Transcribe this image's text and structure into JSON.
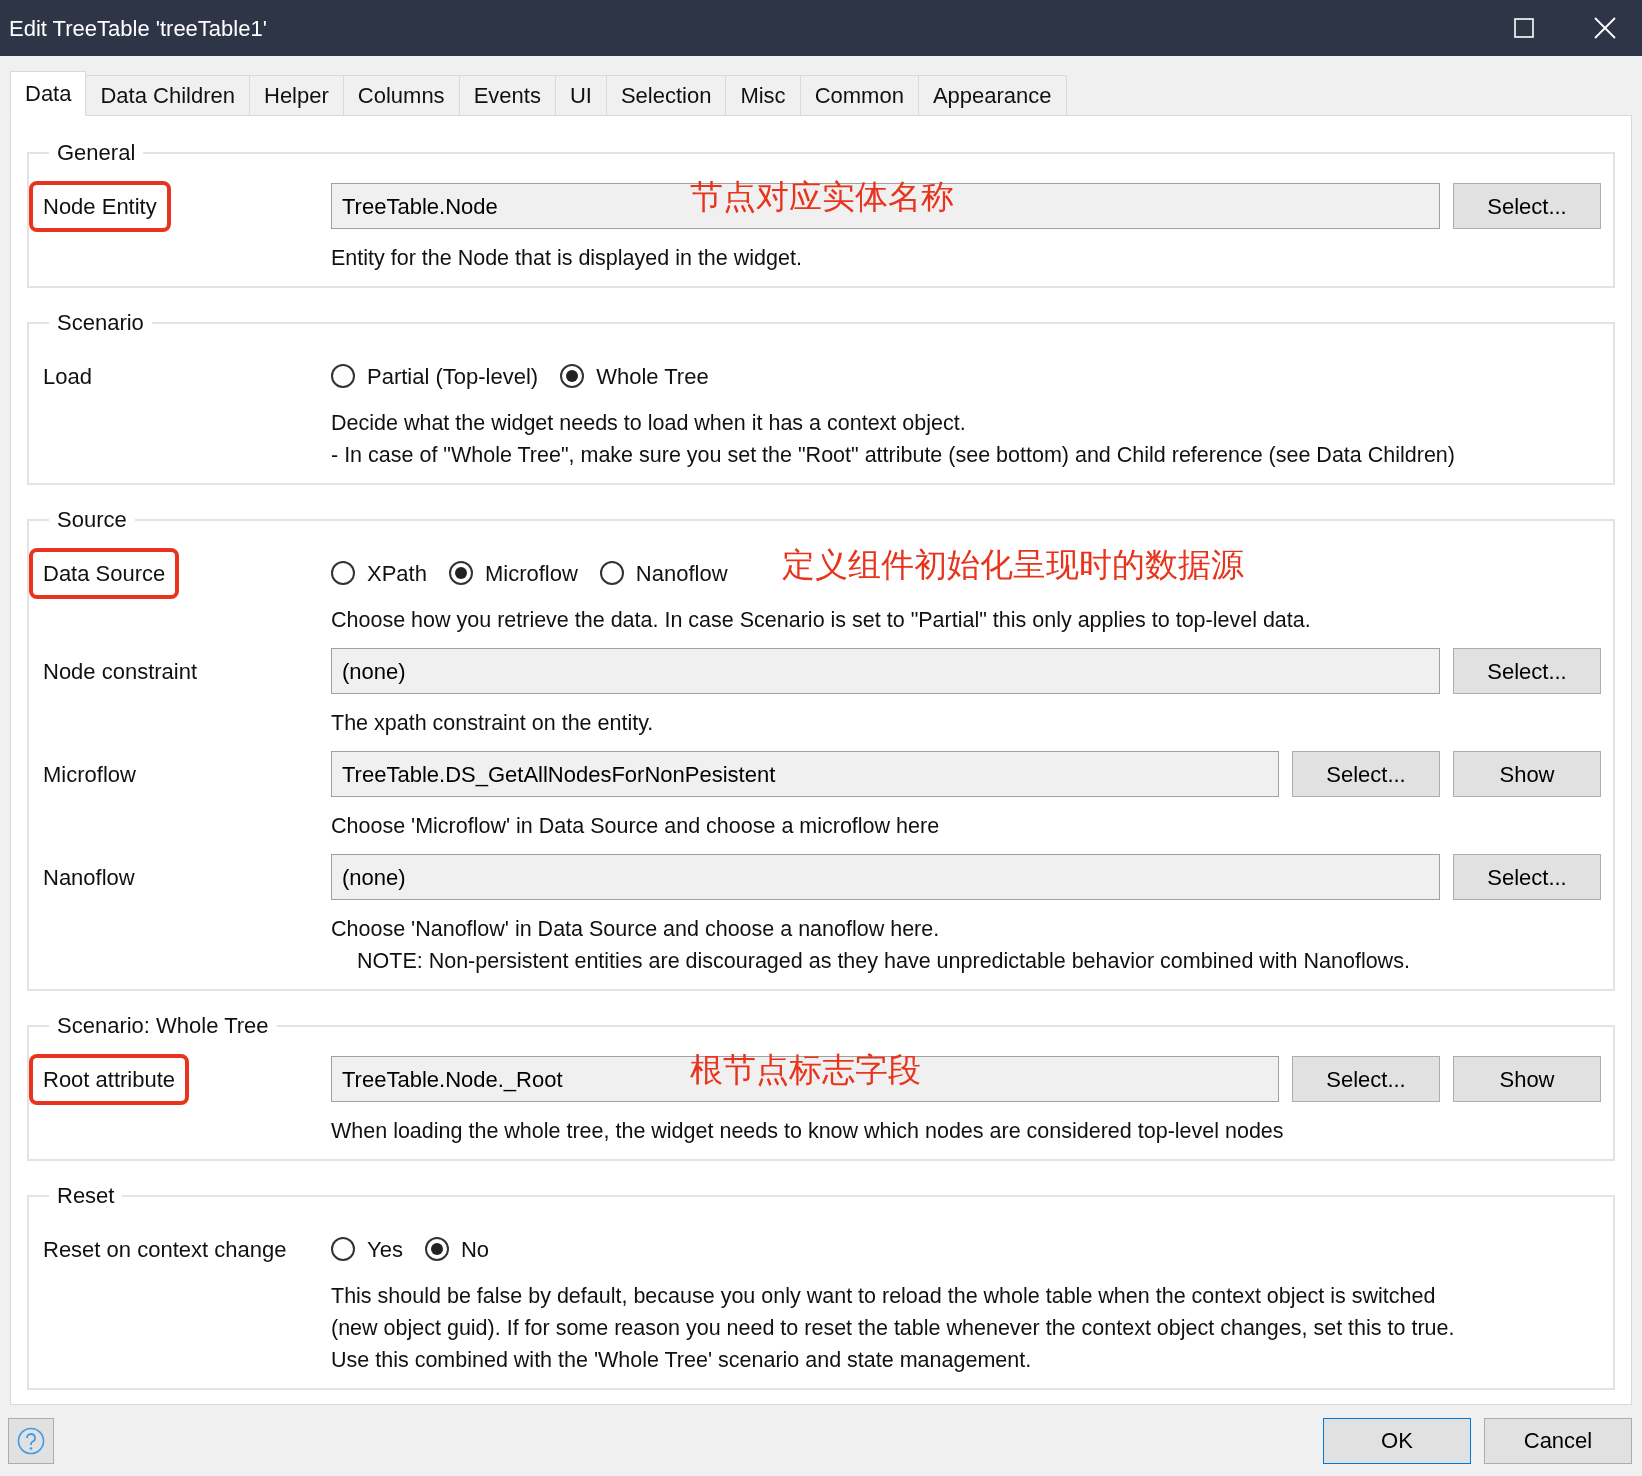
{
  "window": {
    "title": "Edit TreeTable 'treeTable1'"
  },
  "tabs": [
    {
      "label": "Data",
      "selected": true
    },
    {
      "label": "Data Children",
      "selected": false
    },
    {
      "label": "Helper",
      "selected": false
    },
    {
      "label": "Columns",
      "selected": false
    },
    {
      "label": "Events",
      "selected": false
    },
    {
      "label": "UI",
      "selected": false
    },
    {
      "label": "Selection",
      "selected": false
    },
    {
      "label": "Misc",
      "selected": false
    },
    {
      "label": "Common",
      "selected": false
    },
    {
      "label": "Appearance",
      "selected": false
    }
  ],
  "sections": [
    {
      "legend": "General",
      "rows": [
        {
          "label": "Node Entity",
          "highlighted": true,
          "kind": "field",
          "value": "TreeTable.Node",
          "annotation": "节点对应实体名称",
          "buttons": [
            "Select..."
          ],
          "notes": [
            {
              "text": "Entity for the Node that is displayed in the widget.",
              "indented": false
            }
          ]
        }
      ]
    },
    {
      "legend": "Scenario",
      "rows": [
        {
          "label": "Load",
          "highlighted": false,
          "kind": "radio",
          "options": [
            {
              "label": "Partial (Top-level)",
              "selected": false
            },
            {
              "label": "Whole Tree",
              "selected": true
            }
          ],
          "notes": [
            {
              "text": "Decide what the widget needs to load when it has a context object.",
              "indented": false
            },
            {
              "text": "- In case of \"Whole Tree\", make sure you set the \"Root\" attribute (see bottom) and Child reference (see Data Children)",
              "indented": false
            }
          ]
        }
      ]
    },
    {
      "legend": "Source",
      "rows": [
        {
          "label": "Data Source",
          "highlighted": true,
          "kind": "radio",
          "options": [
            {
              "label": "XPath",
              "selected": false
            },
            {
              "label": "Microflow",
              "selected": true
            },
            {
              "label": "Nanoflow",
              "selected": false
            }
          ],
          "annotation": "定义组件初始化呈现时的数据源",
          "notes": [
            {
              "text": "Choose how you retrieve the data. In case Scenario is set to \"Partial\" this only applies to top-level data.",
              "indented": false
            }
          ]
        },
        {
          "label": "Node constraint",
          "highlighted": false,
          "kind": "field",
          "value": "(none)",
          "buttons": [
            "Select..."
          ],
          "notes": [
            {
              "text": "The xpath constraint on the entity.",
              "indented": false
            }
          ]
        },
        {
          "label": "Microflow",
          "highlighted": false,
          "kind": "field",
          "value": "TreeTable.DS_GetAllNodesForNonPesistent",
          "buttons": [
            "Select...",
            "Show"
          ],
          "notes": [
            {
              "text": "Choose 'Microflow' in Data Source and choose a microflow here",
              "indented": false
            }
          ]
        },
        {
          "label": "Nanoflow",
          "highlighted": false,
          "kind": "field",
          "value": "(none)",
          "buttons": [
            "Select..."
          ],
          "notes": [
            {
              "text": "Choose 'Nanoflow' in Data Source and choose a nanoflow here.",
              "indented": false
            },
            {
              "text": "NOTE: Non-persistent entities are discouraged as they have unpredictable behavior combined with Nanoflows.",
              "indented": true
            }
          ]
        }
      ]
    },
    {
      "legend": "Scenario: Whole Tree",
      "rows": [
        {
          "label": "Root attribute",
          "highlighted": true,
          "kind": "field",
          "value": "TreeTable.Node._Root",
          "annotation": "根节点标志字段",
          "buttons": [
            "Select...",
            "Show"
          ],
          "notes": [
            {
              "text": "When loading the whole tree, the widget needs to know which nodes are considered top-level nodes",
              "indented": false
            }
          ]
        }
      ]
    },
    {
      "legend": "Reset",
      "rows": [
        {
          "label": "Reset on context change",
          "highlighted": false,
          "kind": "radio",
          "options": [
            {
              "label": "Yes",
              "selected": false
            },
            {
              "label": "No",
              "selected": true
            }
          ],
          "notes": [
            {
              "text": "This should be false by default, because you only want to reload the whole table when the context object is switched",
              "indented": false
            },
            {
              "text": "(new object guid). If for some reason you need to reset the table whenever the context object changes, set this to true.",
              "indented": false
            },
            {
              "text": "Use this combined with the 'Whole Tree' scenario and state management.",
              "indented": false
            }
          ]
        }
      ]
    }
  ],
  "footer": {
    "buttons": [
      "OK",
      "Cancel"
    ]
  }
}
